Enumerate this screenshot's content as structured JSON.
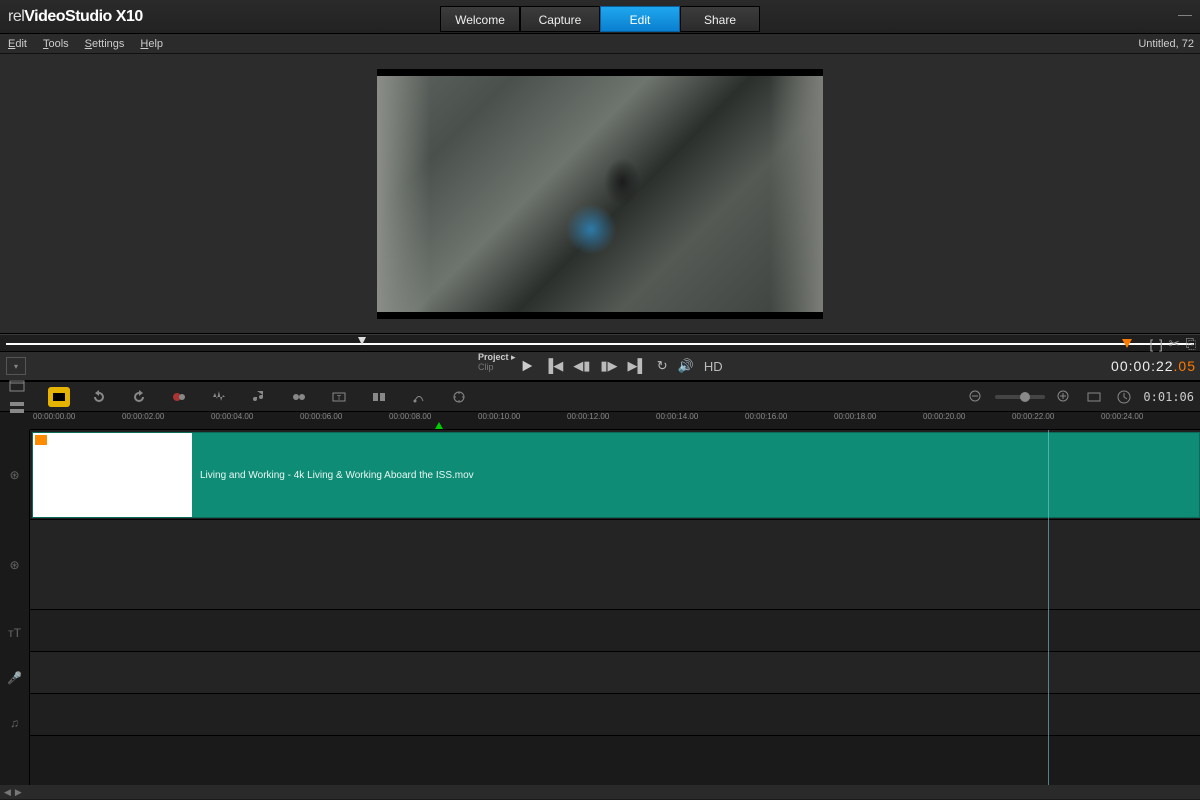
{
  "title": {
    "prefix": "rel",
    "mid": "VideoStudio",
    "suffix": "X10"
  },
  "main_tabs": [
    "Welcome",
    "Capture",
    "Edit",
    "Share"
  ],
  "main_tab_active": 2,
  "menu": [
    "Edit",
    "Tools",
    "Settings",
    "Help"
  ],
  "project_name": "Untitled, 72",
  "scrub_icons": [
    "[",
    "]",
    "✂",
    "⎘"
  ],
  "transport": {
    "mode_top": "Project",
    "mode_bottom": "Clip",
    "hd": "HD",
    "timecode": "00:00:22",
    "timecode_frames": ".05"
  },
  "toolbar_right": {
    "duration": "0:01:06"
  },
  "ruler": {
    "ticks": [
      "00:00:00.00",
      "00:00:02.00",
      "00:00:04.00",
      "00:00:06.00",
      "00:00:08.00",
      "00:00:10.00",
      "00:00:12.00",
      "00:00:14.00",
      "00:00:16.00",
      "00:00:18.00",
      "00:00:20.00",
      "00:00:22.00",
      "00:00:24.00"
    ],
    "tick_start": 3,
    "tick_gap": 89
  },
  "clip": {
    "name": "Living and Working - 4k Living & Working Aboard the ISS.mov"
  }
}
